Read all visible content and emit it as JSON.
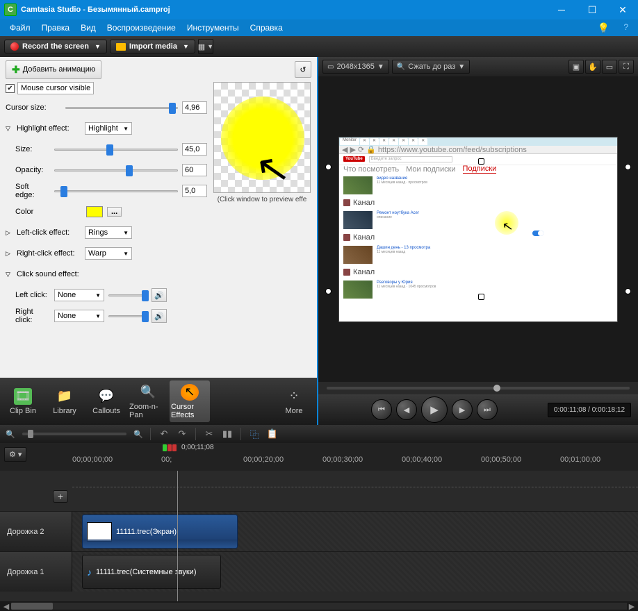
{
  "window": {
    "title": "Camtasia Studio - Безымянный.camproj"
  },
  "menu": {
    "file": "Файл",
    "edit": "Правка",
    "view": "Вид",
    "play": "Воспроизведение",
    "tools": "Инструменты",
    "help": "Справка"
  },
  "toolbar": {
    "record": "Record the screen",
    "import": "Import media"
  },
  "cfx": {
    "add_animation": "Добавить анимацию",
    "mouse_visible": "Mouse cursor visible",
    "cursor_size_lbl": "Cursor size:",
    "cursor_size_val": "4,96",
    "highlight_lbl": "Highlight effect:",
    "highlight_val": "Highlight",
    "size_lbl": "Size:",
    "size_val": "45,0",
    "opacity_lbl": "Opacity:",
    "opacity_val": "60",
    "soft_lbl": "Soft edge:",
    "soft_val": "5,0",
    "color_lbl": "Color",
    "left_effect_lbl": "Left-click effect:",
    "left_effect_val": "Rings",
    "right_effect_lbl": "Right-click effect:",
    "right_effect_val": "Warp",
    "sound_lbl": "Click sound effect:",
    "left_click_lbl": "Left click:",
    "left_click_val": "None",
    "right_click_lbl": "Right click:",
    "right_click_val": "None",
    "preview_hint": "(Click window to preview effe"
  },
  "tabs": {
    "clipbin": "Clip Bin",
    "library": "Library",
    "callouts": "Callouts",
    "zoom": "Zoom-n-Pan",
    "cursor": "Cursor Effects",
    "more": "More"
  },
  "preview": {
    "dims": "2048x1365",
    "shrink": "Сжать до раз",
    "time": "0:00:11;08 / 0:00:18;12",
    "yt_search": "Введите запрос",
    "nav_sub": "Подписки"
  },
  "timeline": {
    "playhead": "0;00;11;08",
    "ticks": [
      "00;00;00;00",
      "00;",
      "00;00;20;00",
      "00;00;30;00",
      "00;00;40;00",
      "00;00;50;00",
      "00;01;00;00"
    ],
    "track2": "Дорожка 2",
    "track1": "Дорожка 1",
    "clip2": "11111.trec(Экран)",
    "clip1": "11111.trec(Системные звуки)"
  }
}
